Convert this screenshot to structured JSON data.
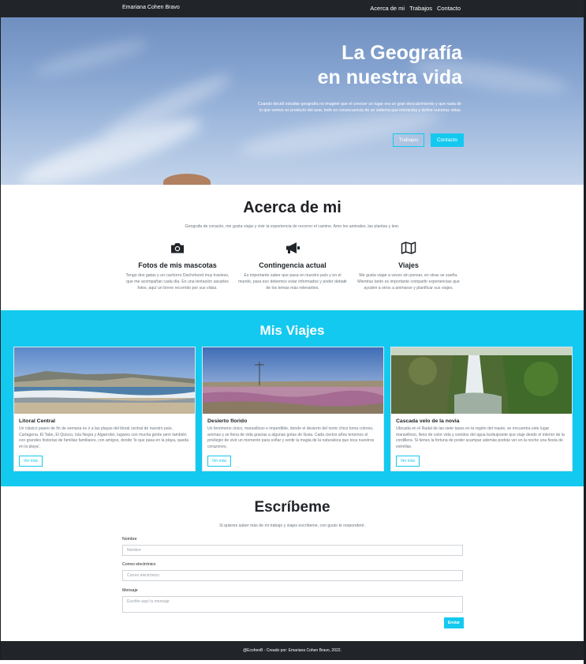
{
  "nav": {
    "brand": "Emariana Cohen Bravo",
    "links": [
      "Acerca de mi",
      "Trabajos",
      "Contacto"
    ]
  },
  "hero": {
    "title_line1": "La Geografía",
    "title_line2": "en nuestra vida",
    "text": "Cuando decidí estudiar geografía no imaginé que el conocer un lugar era un gran descubrimiento y que nada de lo que vemos es producto del azar, todo es consecuencia de un sistema que interactúa y define nuestras vidas.",
    "btn_trabajos": "Trabajos",
    "btn_contacto": "Contacto"
  },
  "about": {
    "title": "Acerca de mi",
    "subtitle": "Geografa de corazón, me gusta viajar y vivir la experiencia de recorrer el camino. Amo los animales, las plantas y leer.",
    "features": [
      {
        "icon": "camera-icon",
        "title": "Fotos de mis mascotas",
        "text": "Tengo dos gatas y un cachorro Dachshund muy travieso, que me acompañan cada día. En una tentación sacarles fotos, aquí un breve recorrido por sus vidas."
      },
      {
        "icon": "megaphone-icon",
        "title": "Contingencia actual",
        "text": "Es importante saber que pasa en nuestro país y en el mundo, para eso debemos estar informados y poder debatir de los temas más relevantes."
      },
      {
        "icon": "map-icon",
        "title": "Viajes",
        "text": "Me gusta viajar a veces sin pensar, en otras se sueña. Mientras tanto es importante compartir experiencias que ayuden a otros a animarse y planificar sus viajes."
      }
    ]
  },
  "viajes": {
    "title": "Mis Viajes",
    "cards": [
      {
        "title": "Litoral Central",
        "text": "Un clásico paseo de fin de semana es ir a las playas del litoral central de nuestro país. Cartagena, El Tabo, El Quisco, Isla Negra y Algarrobo, lugares con mucha gente pero también con grandes historias de familias familiares, con amigos, donde 'lo que pasa en la playa, queda en la playa'.",
        "button": "Ver más"
      },
      {
        "title": "Desierto florido",
        "text": "Un fenómeno único, maravilloso e imperdible, donde el desierto del norte chico toma colores, aromas y se llena de vida gracias a algunas gotas de lluvia. Cada ciertos años tenemos el privilegio de vivir un momento para soñar y sentir la magia de la naturaleza que toca nuestros corazones.",
        "button": "Ver más"
      },
      {
        "title": "Cascada velo de la novia",
        "text": "Ubicada en el Radal de las siete tazas en la región del maule, se encuentra este lugar maravilloso, lleno de color vida y sonidos del agua burbujeante que viaje desde el interior de la cordillera. Si tienes la fortuna de poder acampar además podrás ver en la noche una fiesta de estrellas.",
        "button": "Ver más"
      }
    ]
  },
  "contact": {
    "title": "Escríbeme",
    "subtitle": "Si quieres saber más de mi trabajo y viajes escríbeme, con gusto te responderé.",
    "name_label": "Nombre",
    "name_placeholder": "Nombre",
    "email_label": "Correo electrónico",
    "email_placeholder": "Correo electrónico",
    "message_label": "Mensaje",
    "message_placeholder": "Escribe aquí tu mensaje",
    "submit": "Enviar"
  },
  "footer": {
    "text": "@EcohenB - Creado por: Emariana Cohen Bravo, 2022."
  },
  "colors": {
    "accent": "#14c9ef",
    "dark": "#212529"
  }
}
